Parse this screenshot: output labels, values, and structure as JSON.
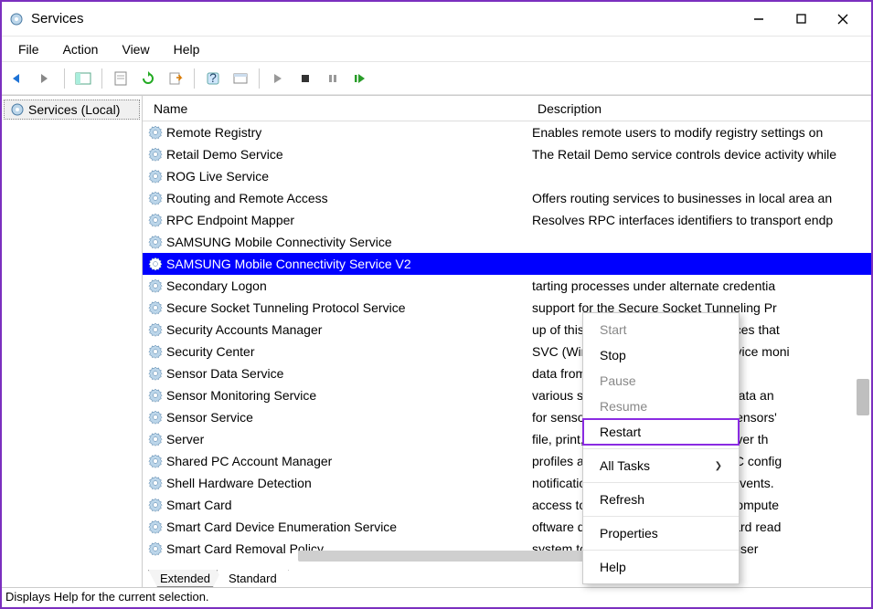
{
  "window": {
    "title": "Services"
  },
  "menu": {
    "file": "File",
    "action": "Action",
    "view": "View",
    "help": "Help"
  },
  "tree": {
    "root": "Services (Local)"
  },
  "columns": {
    "name": "Name",
    "description": "Description"
  },
  "tabs": {
    "extended": "Extended",
    "standard": "Standard"
  },
  "selected_index": 5,
  "services": [
    {
      "name": "Remote Registry",
      "desc": "Enables remote users to modify registry settings on "
    },
    {
      "name": "Retail Demo Service",
      "desc": "The Retail Demo service controls device activity while"
    },
    {
      "name": "ROG Live Service",
      "desc": ""
    },
    {
      "name": "Routing and Remote Access",
      "desc": "Offers routing services to businesses in local area an"
    },
    {
      "name": "RPC Endpoint Mapper",
      "desc": "Resolves RPC interfaces identifiers to transport endp"
    },
    {
      "name": "SAMSUNG Mobile Connectivity Service",
      "desc": ""
    },
    {
      "name": "SAMSUNG Mobile Connectivity Service V2",
      "desc": ""
    },
    {
      "name": "Secondary Logon",
      "desc": "tarting processes under alternate credentia"
    },
    {
      "name": "Secure Socket Tunneling Protocol Service",
      "desc": "support for the Secure Socket Tunneling Pr"
    },
    {
      "name": "Security Accounts Manager",
      "desc": "up of this service signals other services that"
    },
    {
      "name": "Security Center",
      "desc": "SVC (Windows Security Center) service moni"
    },
    {
      "name": "Sensor Data Service",
      "desc": "data from a variety of sensors"
    },
    {
      "name": "Sensor Monitoring Service",
      "desc": "various sensors in order to expose data an"
    },
    {
      "name": "Sensor Service",
      "desc": "for sensors that manages different sensors'"
    },
    {
      "name": "Server",
      "desc": "file, print, and named-pipe sharing over th"
    },
    {
      "name": "Shared PC Account Manager",
      "desc": "profiles and accounts on a SharedPC config"
    },
    {
      "name": "Shell Hardware Detection",
      "desc": "notifications for AutoPlay hardware events."
    },
    {
      "name": "Smart Card",
      "desc": "access to smart cards read by this compute"
    },
    {
      "name": "Smart Card Device Enumeration Service",
      "desc": "oftware device nodes for all smart card read"
    },
    {
      "name": "Smart Card Removal Policy",
      "desc": "system to be configured to lock the user"
    }
  ],
  "context_menu": {
    "start": "Start",
    "stop": "Stop",
    "pause": "Pause",
    "resume": "Resume",
    "restart": "Restart",
    "all_tasks": "All Tasks",
    "refresh": "Refresh",
    "properties": "Properties",
    "help": "Help"
  },
  "status": "Displays Help for the current selection."
}
